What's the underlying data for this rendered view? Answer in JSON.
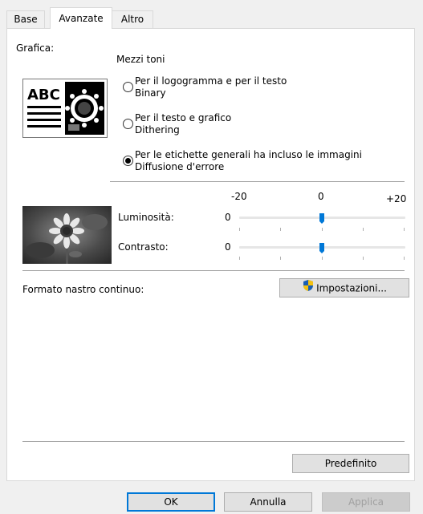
{
  "tabs": [
    {
      "label": "Base"
    },
    {
      "label": "Avanzate"
    },
    {
      "label": "Altro"
    }
  ],
  "graphics": {
    "section_label": "Grafica:",
    "preview_text": "ABC",
    "halftone_label": "Mezzi toni",
    "options": [
      {
        "title": "Per il logogramma e per il testo",
        "subtitle": "Binary",
        "selected": false
      },
      {
        "title": "Per il testo e grafico",
        "subtitle": "Dithering",
        "selected": false
      },
      {
        "title": "Per le etichette generali ha incluso le immagini",
        "subtitle": "Diffusione d'errore",
        "selected": true
      }
    ]
  },
  "adjust": {
    "scale_min": "-20",
    "scale_mid": "0",
    "scale_max": "+20",
    "brightness": {
      "label": "Luminosità:",
      "value": "0",
      "level": 0
    },
    "contrast": {
      "label": "Contrasto:",
      "value": "0",
      "level": 0
    }
  },
  "tape": {
    "label": "Formato nastro continuo:",
    "settings_button": "Impostazioni..."
  },
  "default_button": "Predefinito",
  "footer": {
    "ok": "OK",
    "cancel": "Annulla",
    "apply": "Applica"
  },
  "colors": {
    "accent": "#0078d7",
    "shield_blue": "#1a5fb4",
    "shield_yellow": "#f5c211"
  }
}
